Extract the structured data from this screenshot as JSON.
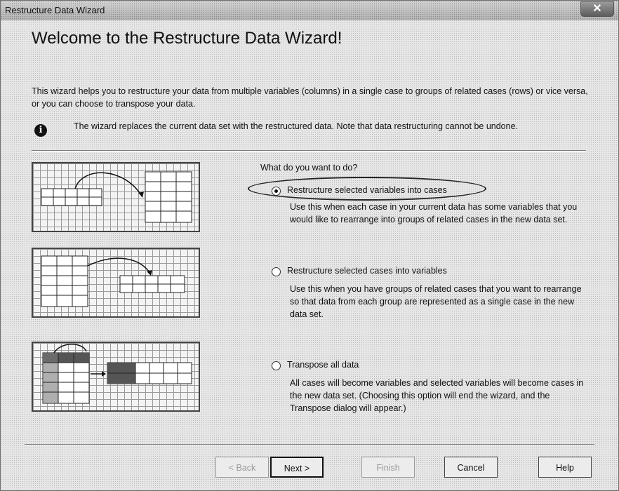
{
  "window": {
    "title": "Restructure Data Wizard",
    "close_glyph": "✕"
  },
  "heading": "Welcome to the Restructure Data Wizard!",
  "intro": "This wizard helps you to restructure your data from multiple variables (columns) in a single case to groups of related cases (rows) or vice versa, or you can choose to transpose your data.",
  "note": {
    "icon": "info-icon",
    "text": "The wizard replaces the current data set with the restructured data.  Note that data restructuring cannot be undone."
  },
  "question": "What do you want to do?",
  "options": [
    {
      "label": "Restructure selected variables into cases",
      "checked": true,
      "description": "Use this when each case in your current data has some variables that you would like to rearrange into groups of related cases in the new data set."
    },
    {
      "label": "Restructure selected cases into variables",
      "checked": false,
      "description": "Use this when you have groups of related cases that you want to rearrange so that data from each group are represented as a single case in the new data set."
    },
    {
      "label": "Transpose all data",
      "checked": false,
      "description": "All cases will become variables and selected variables will become cases in the new data set. (Choosing this option will end the wizard, and the Transpose dialog will appear.)"
    }
  ],
  "buttons": {
    "back": "< Back",
    "next": "Next >",
    "finish": "Finish",
    "cancel": "Cancel",
    "help": "Help"
  }
}
